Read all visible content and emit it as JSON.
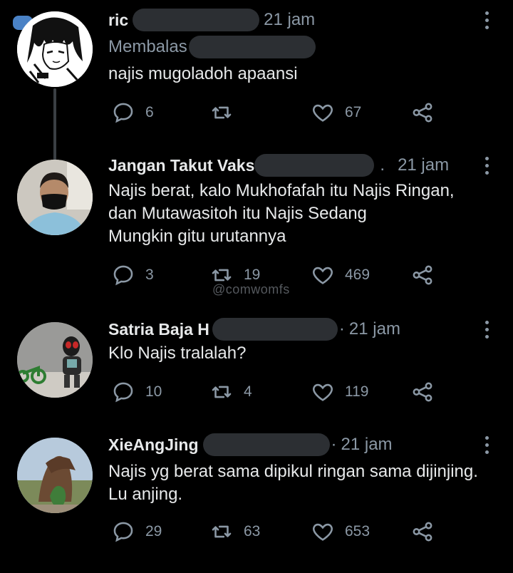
{
  "tweets": [
    {
      "name": "ric",
      "time": "21 jam",
      "replying_label": "Membalas",
      "text": "najis mugoladoh apaansi",
      "reply_count": "6",
      "retweet_count": "",
      "like_count": "67"
    },
    {
      "name": "Jangan Takut Vaks",
      "time": "21 jam",
      "text": "Najis berat, kalo Mukhofafah itu Najis Ringan,\ndan Mutawasitoh itu Najis Sedang\nMungkin gitu urutannya",
      "reply_count": "3",
      "retweet_count": "19",
      "like_count": "469"
    },
    {
      "name": "Satria Baja H",
      "time": "21 jam",
      "text": "Klo Najis tralalah?",
      "reply_count": "10",
      "retweet_count": "4",
      "like_count": "119"
    },
    {
      "name": "XieAngJing",
      "time": "21 jam",
      "text": "Najis yg berat sama dipikul ringan sama dijinjing.\nLu anjing.",
      "reply_count": "29",
      "retweet_count": "63",
      "like_count": "653"
    }
  ],
  "watermark": "@comwomfs",
  "icons": {
    "reply": "reply-icon",
    "retweet": "retweet-icon",
    "like": "heart-icon",
    "share": "share-icon",
    "more": "more-icon"
  },
  "colors": {
    "background": "#000000",
    "text": "#e7e9ea",
    "muted": "#8b98a5",
    "redaction": "#2c2f33"
  }
}
